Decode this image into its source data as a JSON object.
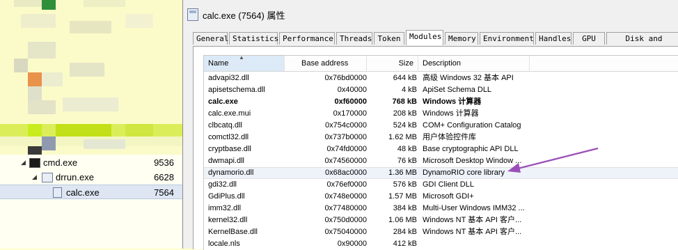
{
  "window": {
    "title": "calc.exe (7564) 属性"
  },
  "tabs": [
    {
      "label": "General"
    },
    {
      "label": "Statistics"
    },
    {
      "label": "Performance"
    },
    {
      "label": "Threads"
    },
    {
      "label": "Token"
    },
    {
      "label": "Modules",
      "active": true
    },
    {
      "label": "Memory"
    },
    {
      "label": "Environment"
    },
    {
      "label": "Handles"
    },
    {
      "label": "GPU"
    },
    {
      "label": "Disk and Network"
    }
  ],
  "list": {
    "columns": {
      "name": "Name",
      "base": "Base address",
      "size": "Size",
      "desc": "Description"
    },
    "rows": [
      {
        "name": "advapi32.dll",
        "base": "0x76bd0000",
        "size": "644 kB",
        "desc": "高级 Windows 32 基本 API"
      },
      {
        "name": "apisetschema.dll",
        "base": "0x40000",
        "size": "4 kB",
        "desc": "ApiSet Schema DLL"
      },
      {
        "name": "calc.exe",
        "base": "0xf60000",
        "size": "768 kB",
        "desc": "Windows 计算器"
      },
      {
        "name": "calc.exe.mui",
        "base": "0x170000",
        "size": "208 kB",
        "desc": "Windows 计算器"
      },
      {
        "name": "clbcatq.dll",
        "base": "0x754c0000",
        "size": "524 kB",
        "desc": "COM+ Configuration Catalog"
      },
      {
        "name": "comctl32.dll",
        "base": "0x737b0000",
        "size": "1.62 MB",
        "desc": "用户体验控件库"
      },
      {
        "name": "cryptbase.dll",
        "base": "0x74fd0000",
        "size": "48 kB",
        "desc": "Base cryptographic API DLL"
      },
      {
        "name": "dwmapi.dll",
        "base": "0x74560000",
        "size": "76 kB",
        "desc": "Microsoft Desktop Window ..."
      },
      {
        "name": "dynamorio.dll",
        "base": "0x68ac0000",
        "size": "1.36 MB",
        "desc": "DynamoRIO core library"
      },
      {
        "name": "gdi32.dll",
        "base": "0x76ef0000",
        "size": "576 kB",
        "desc": "GDI Client DLL"
      },
      {
        "name": "GdiPlus.dll",
        "base": "0x748e0000",
        "size": "1.57 MB",
        "desc": "Microsoft GDI+"
      },
      {
        "name": "imm32.dll",
        "base": "0x77480000",
        "size": "384 kB",
        "desc": "Multi-User Windows IMM32 ..."
      },
      {
        "name": "kernel32.dll",
        "base": "0x750d0000",
        "size": "1.06 MB",
        "desc": "Windows NT 基本 API 客户..."
      },
      {
        "name": "KernelBase.dll",
        "base": "0x75040000",
        "size": "284 kB",
        "desc": "Windows NT 基本 API 客户..."
      },
      {
        "name": "locale.nls",
        "base": "0x90000",
        "size": "412 kB",
        "desc": ""
      }
    ]
  },
  "tree": [
    {
      "name": "cmd.exe",
      "pid": "9536",
      "icon": "console-icon"
    },
    {
      "name": "drrun.exe",
      "pid": "6628",
      "icon": "window-icon"
    },
    {
      "name": "calc.exe",
      "pid": "7564",
      "icon": "calculator-icon"
    }
  ],
  "colors": {
    "annotation_arrow": "#9b4fb8",
    "selection": "#dde6f2",
    "mosaic_green": "#c9ec1e",
    "mosaic_orange": "#e8924a"
  }
}
